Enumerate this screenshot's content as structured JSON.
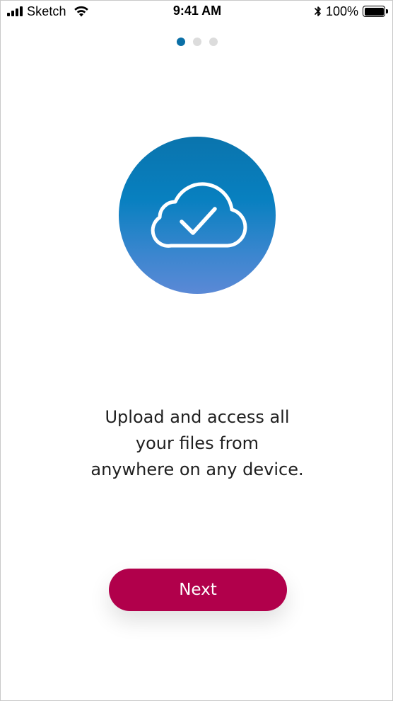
{
  "status_bar": {
    "carrier": "Sketch",
    "time": "9:41 AM",
    "battery_percent": "100%",
    "signal_icon": "cellular-signal-icon",
    "wifi_icon": "wifi-icon",
    "bluetooth_icon": "bluetooth-icon",
    "battery_icon": "battery-icon",
    "battery_level": 1.0
  },
  "pager": {
    "total_pages": 3,
    "current_page": 1,
    "active_color": "#0a6fa6",
    "inactive_color": "#dcdcdc"
  },
  "illustration": {
    "icon": "cloud-check-icon",
    "gradient_top": "#0a74ad",
    "gradient_bottom": "#5b89d6"
  },
  "onboarding": {
    "message_lines": [
      "Upload and access all",
      "your files from",
      "anywhere on any device."
    ]
  },
  "actions": {
    "next_label": "Next",
    "next_color": "#b1004b"
  }
}
